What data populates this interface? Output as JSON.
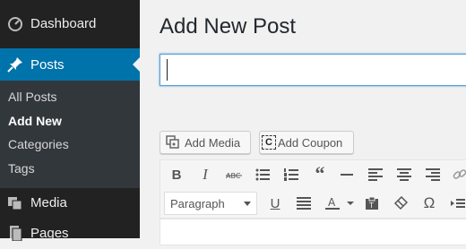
{
  "sidebar": {
    "dashboard_label": "Dashboard",
    "posts_label": "Posts",
    "submenu": [
      "All Posts",
      "Add New",
      "Categories",
      "Tags"
    ],
    "media_label": "Media",
    "pages_label": "Pages",
    "active_color": "#0073aa",
    "bg_color": "#222222"
  },
  "main": {
    "title": "Add New Post",
    "title_input_value": ""
  },
  "buttons": {
    "add_media": "Add Media",
    "add_coupon": "Add Coupon",
    "coupon_icon_letter": "C"
  },
  "toolbar": {
    "format_value": "Paragraph",
    "icons_row1": [
      "bold-icon",
      "italic-icon",
      "strikethrough-icon",
      "bullet-list-icon",
      "numbered-list-icon",
      "blockquote-icon",
      "horizontal-rule-icon",
      "align-left-icon",
      "align-center-icon",
      "align-right-icon",
      "link-icon"
    ],
    "icons_row2": [
      "underline-icon",
      "justify-icon",
      "text-color-icon",
      "paste-as-text-icon",
      "clear-formatting-icon",
      "special-character-icon",
      "indent-icon"
    ]
  }
}
